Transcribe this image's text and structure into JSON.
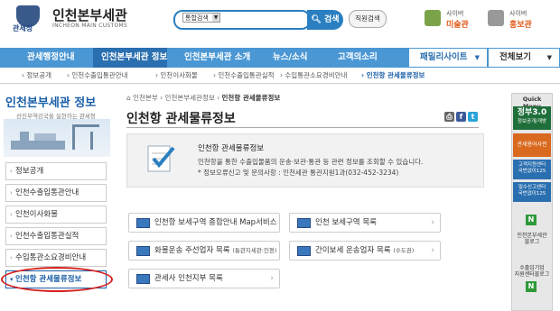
{
  "header": {
    "logo_sub": "관세청",
    "brand_title": "인천본부세관",
    "brand_en": "INCHEON MAIN CUSTOMS",
    "search": {
      "select_value": "통합검색",
      "button_label": "검색"
    },
    "staff_button": "직원검색",
    "cyber_museum": {
      "line1": "사이버",
      "line2": "미술관"
    },
    "cyber_pr": {
      "line1": "사이버",
      "line2": "홍보관"
    }
  },
  "nav": {
    "items": [
      "관세행정안내",
      "인천본부세관 정보",
      "인천본부세관 소개",
      "뉴스/소식",
      "고객의소리"
    ],
    "family": "패밀리사이트",
    "fullview": "전체보기"
  },
  "subnav": {
    "items": [
      "정보공개",
      "인천수출입통관안내",
      "인천이사화물",
      "인천수출입통관실적",
      "수입통관소요경비안내",
      "인천항 관세물류정보"
    ]
  },
  "sidebar": {
    "title": "인천본부세관 정보",
    "subtitle": "선진무역강국을 실현하는 관세청",
    "items": [
      "정보공개",
      "인천수출입통관안내",
      "인천이사화물",
      "인천수출입통관실적",
      "수입통관소요경비안내",
      "인천항 관세물류정보"
    ]
  },
  "content": {
    "breadcrumb": [
      "인천본부",
      "인천본부세관정보",
      "인천항 관세물류정보"
    ],
    "title": "인천항 관세물류정보",
    "info": {
      "title": "인천항 관세물류정보",
      "desc": "인천항을 통한 수출입물품의 운송·보관·통관 등 관련 정보를 조회할 수 있습니다.",
      "contact": "* 정보오류신고 및 문의사항 : 인천세관 통관지원1과(032-452-3234)"
    },
    "links": [
      {
        "label": "인천항 보세구역 종합안내 Map서비스",
        "small": ""
      },
      {
        "label": "인천 보세구역 목록",
        "small": ""
      },
      {
        "label": "화물운송 주선업자 목록",
        "small": "(통관지세관:인천)"
      },
      {
        "label": "간이보세 운송업자 목록",
        "small": "(수도권)"
      },
      {
        "label": "관세사 인천지부 목록",
        "small": ""
      }
    ]
  },
  "quick": {
    "title": "Quick Menu",
    "block1": {
      "line1": "정부3.0",
      "line2": "정보공개/개방"
    },
    "block2": {
      "line1": "관세용어사전"
    },
    "block3": {
      "line1": "고객지원센터",
      "line2": "국번없이125"
    },
    "block4": {
      "line1": "밀수신고센터",
      "line2": "국번없이125"
    },
    "item1": {
      "line1": "인천본부세관",
      "line2": "블로그"
    },
    "item2": {
      "line1": "수출입기업",
      "line2": "지원센터블로그"
    },
    "badge": "N"
  },
  "colors": {
    "nav": "#4a97d4",
    "nav_active": "#2a6fb0",
    "accent": "#1b5fa8",
    "highlight": "#d62020"
  }
}
